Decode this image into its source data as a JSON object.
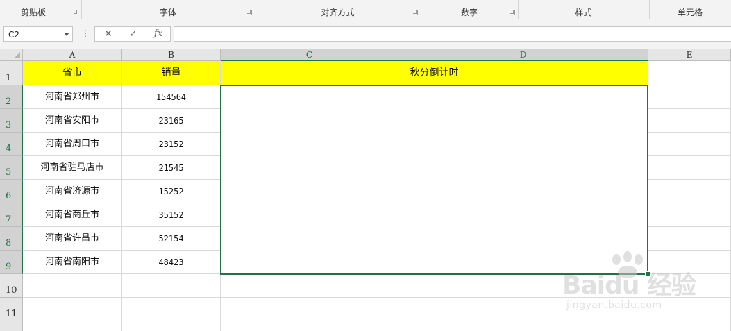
{
  "ribbon": {
    "groups": [
      {
        "label": "剪贴板",
        "launcher": true
      },
      {
        "label": "字体",
        "launcher": true
      },
      {
        "label": "对齐方式",
        "launcher": true
      },
      {
        "label": "数字",
        "launcher": true
      },
      {
        "label": "样式",
        "launcher": false
      },
      {
        "label": "单元格",
        "launcher": false
      }
    ]
  },
  "formula_bar": {
    "name_box": "C2",
    "cancel_icon": "✕",
    "enter_icon": "✓",
    "fx_icon": "fx",
    "formula": ""
  },
  "sheet": {
    "columns": [
      "A",
      "B",
      "C",
      "D",
      "E"
    ],
    "selected_columns": [
      "C",
      "D"
    ],
    "rows": [
      "1",
      "2",
      "3",
      "4",
      "5",
      "6",
      "7",
      "8",
      "9",
      "10",
      "11"
    ],
    "selected_rows": [
      "2",
      "3",
      "4",
      "5",
      "6",
      "7",
      "8",
      "9"
    ],
    "header": {
      "province_city": "省市",
      "sales": "销量",
      "countdown": "秋分倒计时"
    },
    "data": [
      {
        "city": "河南省郑州市",
        "sales": "154564"
      },
      {
        "city": "河南省安阳市",
        "sales": "23165"
      },
      {
        "city": "河南省周口市",
        "sales": "23152"
      },
      {
        "city": "河南省驻马店市",
        "sales": "21545"
      },
      {
        "city": "河南省济源市",
        "sales": "15252"
      },
      {
        "city": "河南省商丘市",
        "sales": "35152"
      },
      {
        "city": "河南省许昌市",
        "sales": "52154"
      },
      {
        "city": "河南省南阳市",
        "sales": "48423"
      }
    ],
    "merged_selection": "C2:D9"
  },
  "watermark": {
    "brand": "Baidu 经验",
    "url": "jingyan.baidu.com"
  },
  "colors": {
    "header_fill": "#ffff00",
    "selection": "#217346"
  }
}
